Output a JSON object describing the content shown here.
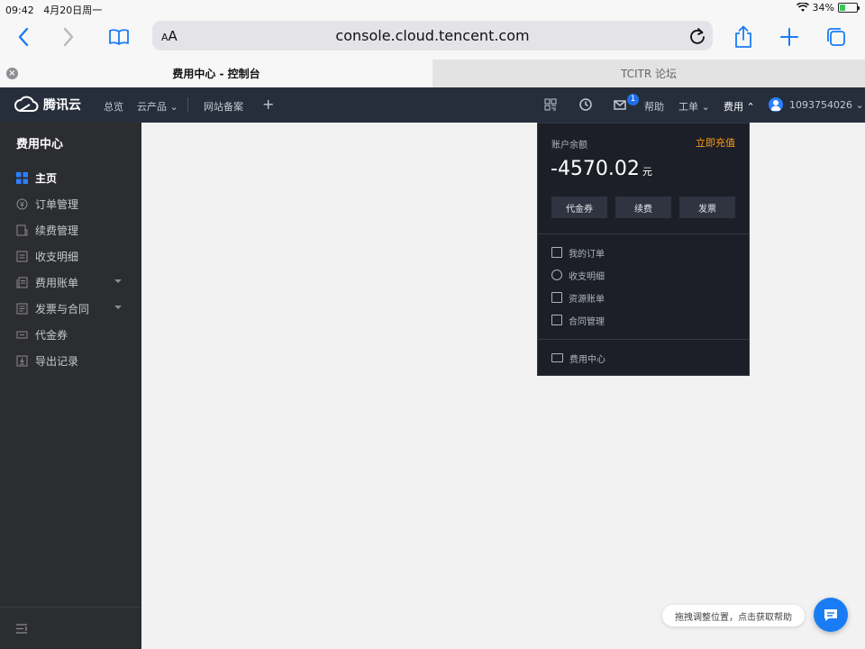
{
  "status_bar": {
    "time": "09:42",
    "date": "4月20日周一",
    "battery": "34%",
    "battery_level": 0.34
  },
  "browser": {
    "address_prefix": "AA",
    "url": "console.cloud.tencent.com",
    "tabs": [
      {
        "title": "费用中心 - 控制台",
        "active": true
      },
      {
        "title": "TCITR 论坛",
        "active": false
      }
    ]
  },
  "topnav": {
    "brand": "腾讯云",
    "left_items": [
      "总览",
      "云产品",
      "网站备案"
    ],
    "mail_badge": "1",
    "help": "帮助",
    "ticket": "工单",
    "billing": "费用",
    "account": "1093754026"
  },
  "sidebar": {
    "title": "费用中心",
    "items": [
      {
        "label": "主页",
        "active": true,
        "icon": "grid-icon"
      },
      {
        "label": "订单管理",
        "icon": "yuan-icon"
      },
      {
        "label": "续费管理",
        "icon": "renew-icon"
      },
      {
        "label": "收支明细",
        "icon": "list-icon"
      },
      {
        "label": "费用账单",
        "icon": "bill-icon",
        "expandable": true
      },
      {
        "label": "发票与合同",
        "icon": "invoice-icon",
        "expandable": true
      },
      {
        "label": "代金券",
        "icon": "voucher-icon"
      },
      {
        "label": "导出记录",
        "icon": "export-icon"
      }
    ]
  },
  "dropdown": {
    "balance_label": "账户余额",
    "recharge": "立即充值",
    "balance": "-4570.02",
    "unit": "元",
    "buttons": [
      "代金券",
      "续费",
      "发票"
    ],
    "links": [
      "我的订单",
      "收支明细",
      "资源账单",
      "合同管理"
    ],
    "footer": "费用中心"
  },
  "help": {
    "tip": "拖拽调整位置，点击获取帮助"
  },
  "colors": {
    "accent": "#1a7cf5",
    "recharge": "#ff9c19",
    "nav_bg": "#262e3c",
    "sidebar_bg": "#2c2d30"
  }
}
